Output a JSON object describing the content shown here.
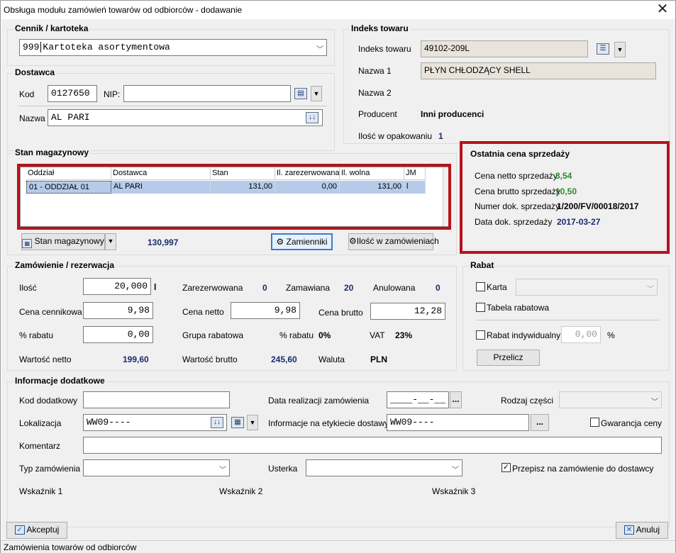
{
  "window": {
    "title": "Obsługa modułu zamówień towarów od odbiorców - dodawanie",
    "close_glyph": "✕"
  },
  "cennik": {
    "legend": "Cennik / kartoteka",
    "code": "999",
    "name": "Kartoteka asortymentowa"
  },
  "dostawca": {
    "legend": "Dostawca",
    "kod_label": "Kod",
    "kod_value": "0127650",
    "nip_label": "NIP:",
    "nip_value": "",
    "nazwa_label": "Nazwa",
    "nazwa_value": "AL PARI"
  },
  "indeks": {
    "legend": "Indeks towaru",
    "indeks_label": "Indeks towaru",
    "indeks_value": "49102-209L",
    "nazwa1_label": "Nazwa 1",
    "nazwa1_value": "PŁYN CHŁODZĄCY SHELL",
    "nazwa2_label": "Nazwa 2",
    "producent_label": "Producent",
    "producent_value": "Inni producenci",
    "ilosc_label": "Ilość w opakowaniu",
    "ilosc_value": "1"
  },
  "stan": {
    "legend": "Stan magazynowy",
    "columns": [
      "Oddział",
      "Dostawca",
      "Stan",
      "Il. zarezerwowana",
      "Il. wolna",
      "JM"
    ],
    "rows": [
      [
        "01 - ODDZIAŁ 01",
        "AL PARI",
        "131,00",
        "0,00",
        "131,00",
        "l"
      ]
    ],
    "btn_stan": "Stan magazynowy",
    "total": "130,997",
    "btn_zamienniki": "Zamienniki",
    "btn_ilosc": "Ilość w zamówieniach"
  },
  "ostatnia": {
    "legend": "Ostatnia cena sprzedaży",
    "netto_label": "Cena netto sprzedaży",
    "netto_value": "8,54",
    "brutto_label": "Cena brutto sprzedaży",
    "brutto_value": "10,50",
    "numer_label": "Numer dok. sprzedaży",
    "numer_value": "1/200/FV/00018/2017",
    "data_label": "Data dok. sprzedaży",
    "data_value": "2017-03-27"
  },
  "zamowienie": {
    "legend": "Zamówienie / rezerwacja",
    "ilosc_label": "Ilość",
    "ilosc_value": "20,000",
    "ilosc_unit": "l",
    "zarezerwowana_label": "Zarezerwowana",
    "zarezerwowana_value": "0",
    "zamawiana_label": "Zamawiana",
    "zamawiana_value": "20",
    "anulowana_label": "Anulowana",
    "anulowana_value": "0",
    "cena_cennikowa_label": "Cena cennikowa",
    "cena_cennikowa_value": "9,98",
    "cena_netto_label": "Cena netto",
    "cena_netto_value": "9,98",
    "cena_brutto_label": "Cena brutto",
    "cena_brutto_value": "12,28",
    "rabat_label": "% rabatu",
    "rabat_value": "0,00",
    "grupa_label": "Grupa rabatowa",
    "grupa_rabat_label": "% rabatu",
    "grupa_rabat_value": "0%",
    "vat_label": "VAT",
    "vat_value": "23%",
    "wartosc_netto_label": "Wartość netto",
    "wartosc_netto_value": "199,60",
    "wartosc_brutto_label": "Wartość brutto",
    "wartosc_brutto_value": "245,60",
    "waluta_label": "Waluta",
    "waluta_value": "PLN"
  },
  "rabat": {
    "legend": "Rabat",
    "karta_label": "Karta",
    "tabela_label": "Tabela rabatowa",
    "indywidualny_label": "Rabat indywidualny",
    "indywidualny_value": "0,00",
    "percent": "%",
    "przelicz": "Przelicz"
  },
  "info": {
    "legend": "Informacje dodatkowe",
    "kod_dod_label": "Kod dodatkowy",
    "kod_dod_value": "",
    "data_real_label": "Data realizacji zamówienia",
    "data_real_value": "____-__-__",
    "rodzaj_label": "Rodzaj części",
    "lokalizacja_label": "Lokalizacja",
    "lokalizacja_value": "WW09----",
    "etykieta_label": "Informacje na etykiecie dostawy",
    "etykieta_value": "WW09----",
    "gwarancja_label": "Gwarancja ceny",
    "komentarz_label": "Komentarz",
    "typ_label": "Typ zamówienia",
    "usterka_label": "Usterka",
    "przepisz_label": "Przepisz na zamówienie do dostawcy",
    "wsk1": "Wskaźnik 1",
    "wsk2": "Wskaźnik 2",
    "wsk3": "Wskaźnik 3",
    "ellipsis": "..."
  },
  "footer": {
    "akceptuj": "Akceptuj",
    "anuluj": "Anuluj",
    "status": "Zamówienia towarów od odbiorców"
  },
  "colors": {
    "accent_red": "#b8121b",
    "value_blue": "#1a2c6e",
    "value_green": "#2e8b2e"
  }
}
